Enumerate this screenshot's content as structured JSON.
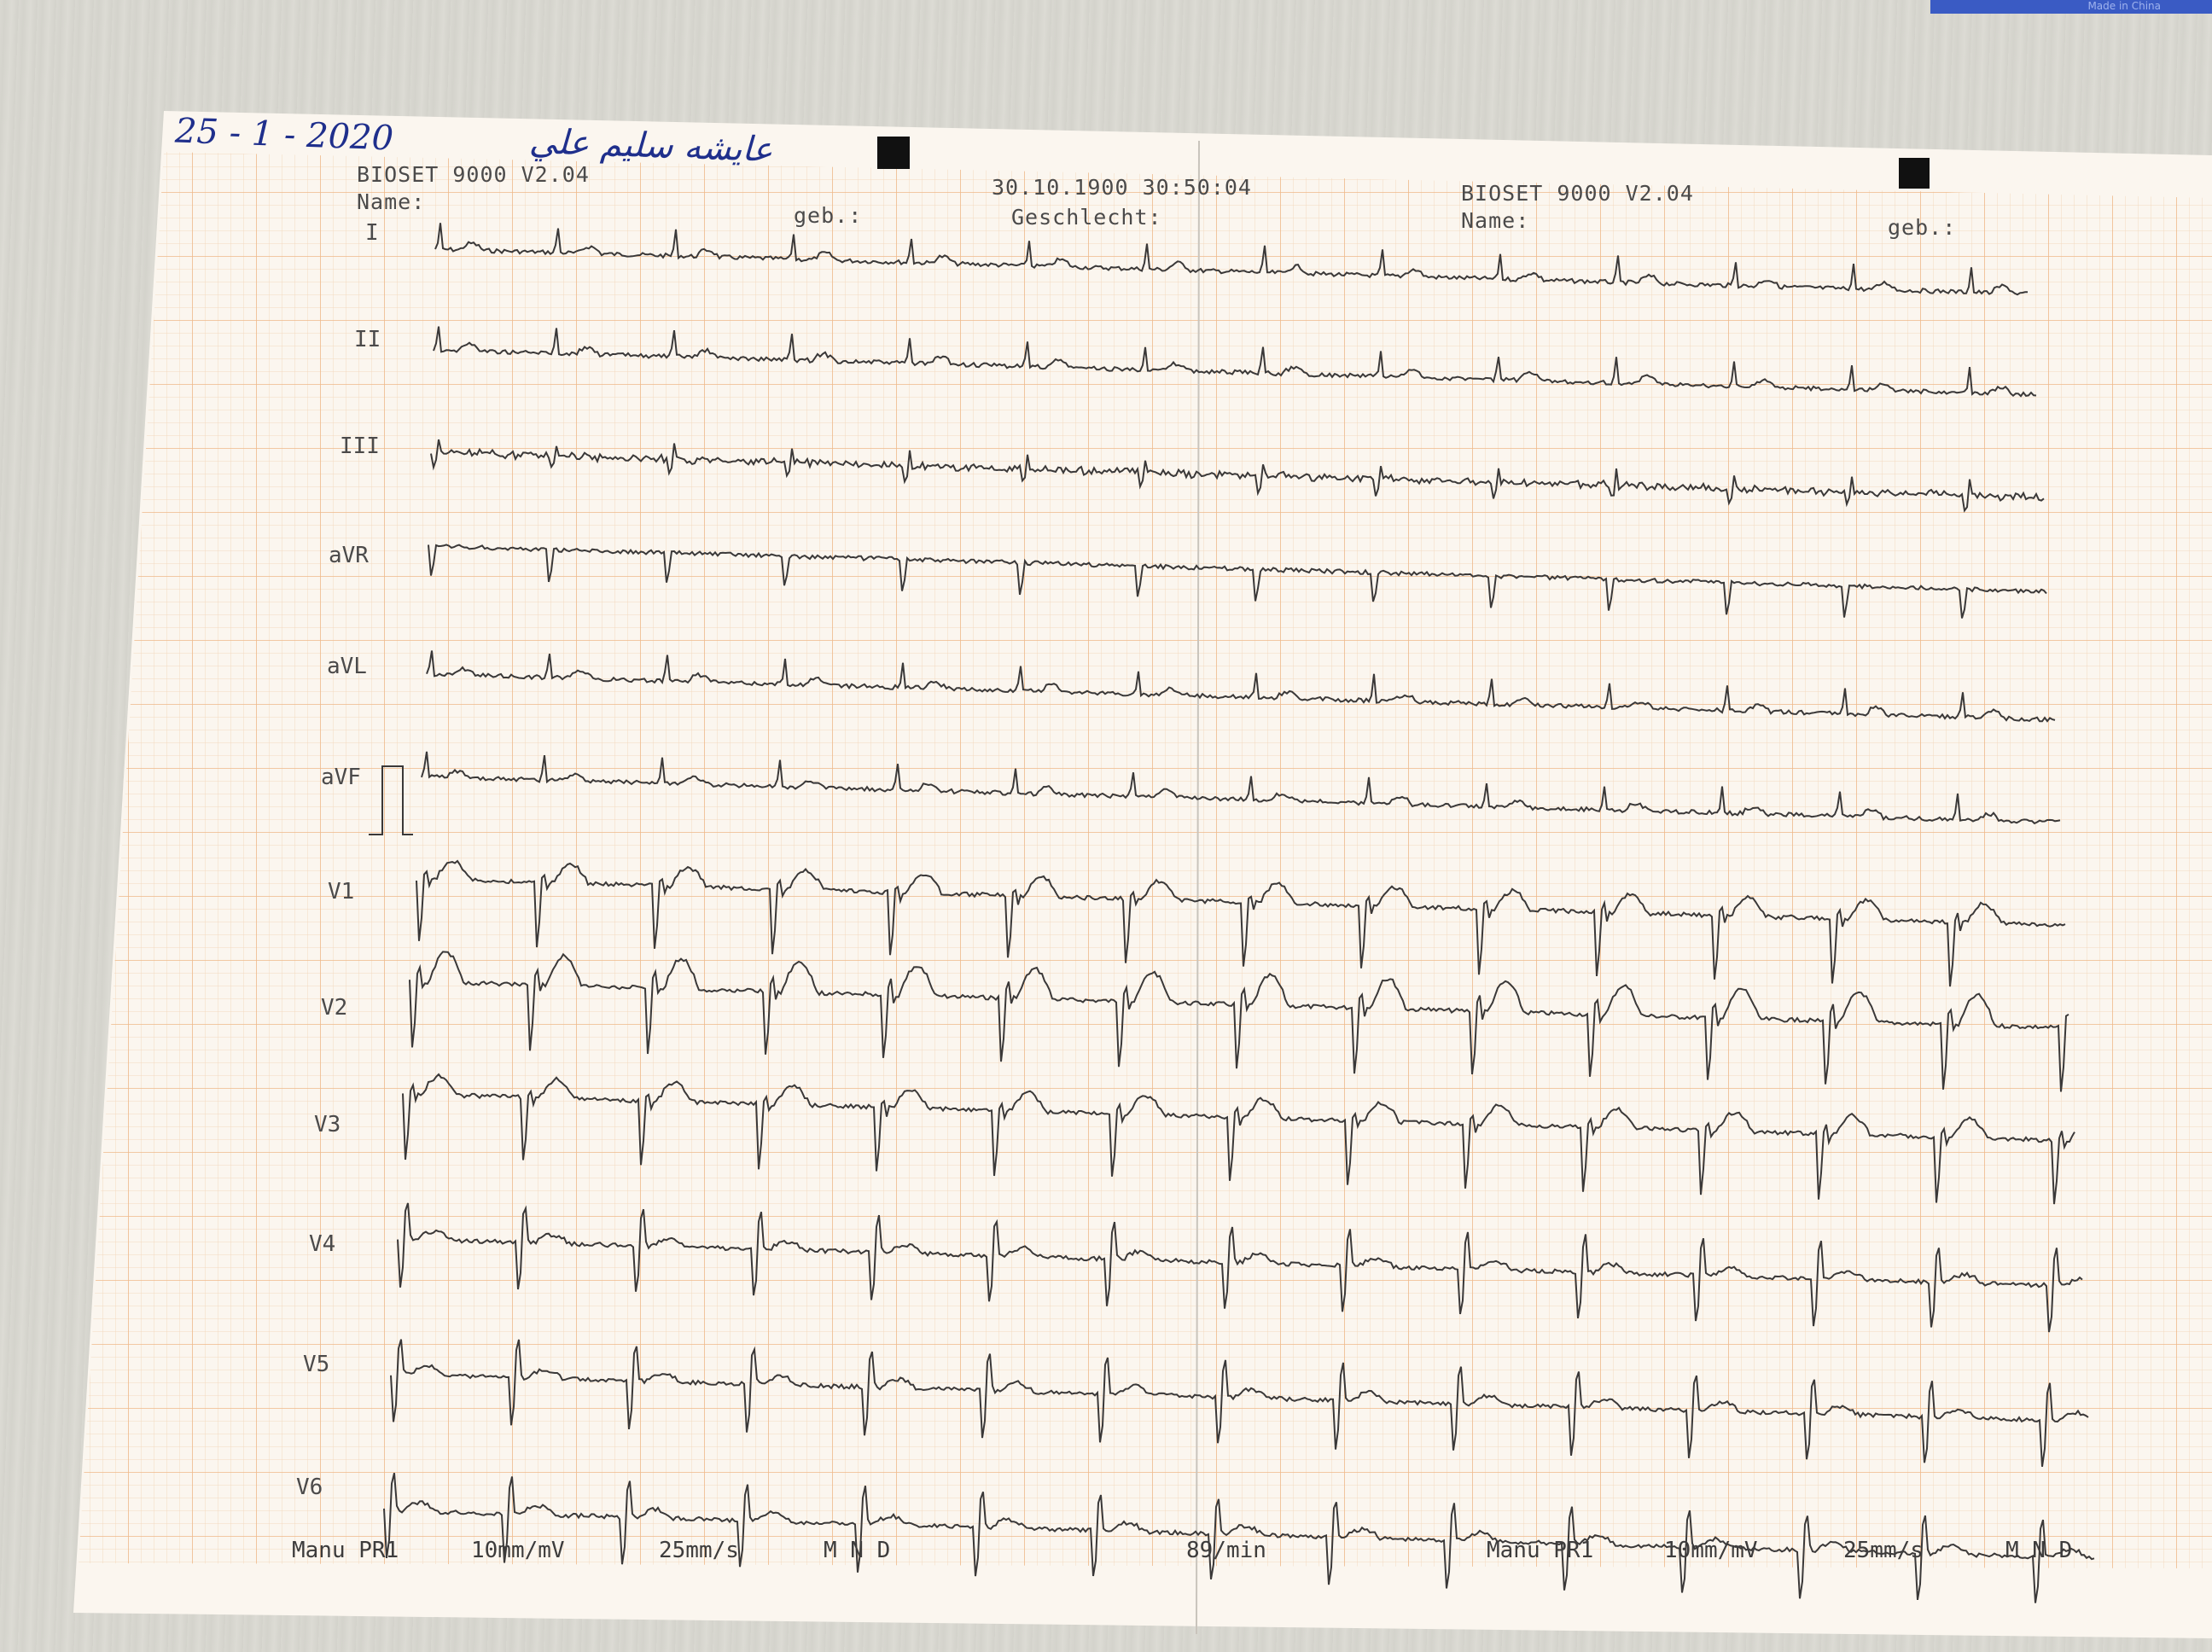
{
  "handwriting": {
    "date": "25 - 1 - 2020",
    "name": "عايشه سليم علي"
  },
  "header_left": {
    "device": "BIOSET 9000 V2.04",
    "name_label": "Name:",
    "geb_label": "geb.:"
  },
  "header_center": {
    "datetime": "30.10.1900 30:50:04",
    "sex_label": "Geschlecht:"
  },
  "header_right": {
    "device": "BIOSET 9000 V2.04",
    "name_label": "Name:",
    "geb_label": "geb.:"
  },
  "leads": [
    "I",
    "II",
    "III",
    "aVR",
    "aVL",
    "aVF",
    "V1",
    "V2",
    "V3",
    "V4",
    "V5",
    "V6"
  ],
  "footer_left": {
    "mode": "Manu PR1",
    "gain": "10mm/mV",
    "speed": "25mm/s",
    "filters": "M  N  D"
  },
  "footer_center": {
    "heart_rate": "89/min"
  },
  "footer_right": {
    "mode": "Manu PR1",
    "gain": "10mm/mV",
    "speed": "25mm/s",
    "filters": "M  N  D"
  },
  "colors": {
    "paper": "#fbf5ee",
    "grid_minor": "#f3d9bf",
    "grid_major": "#efb98a",
    "trace": "#3a3838",
    "ink": "#1f2f8c"
  },
  "corner_label": "Made in China"
}
